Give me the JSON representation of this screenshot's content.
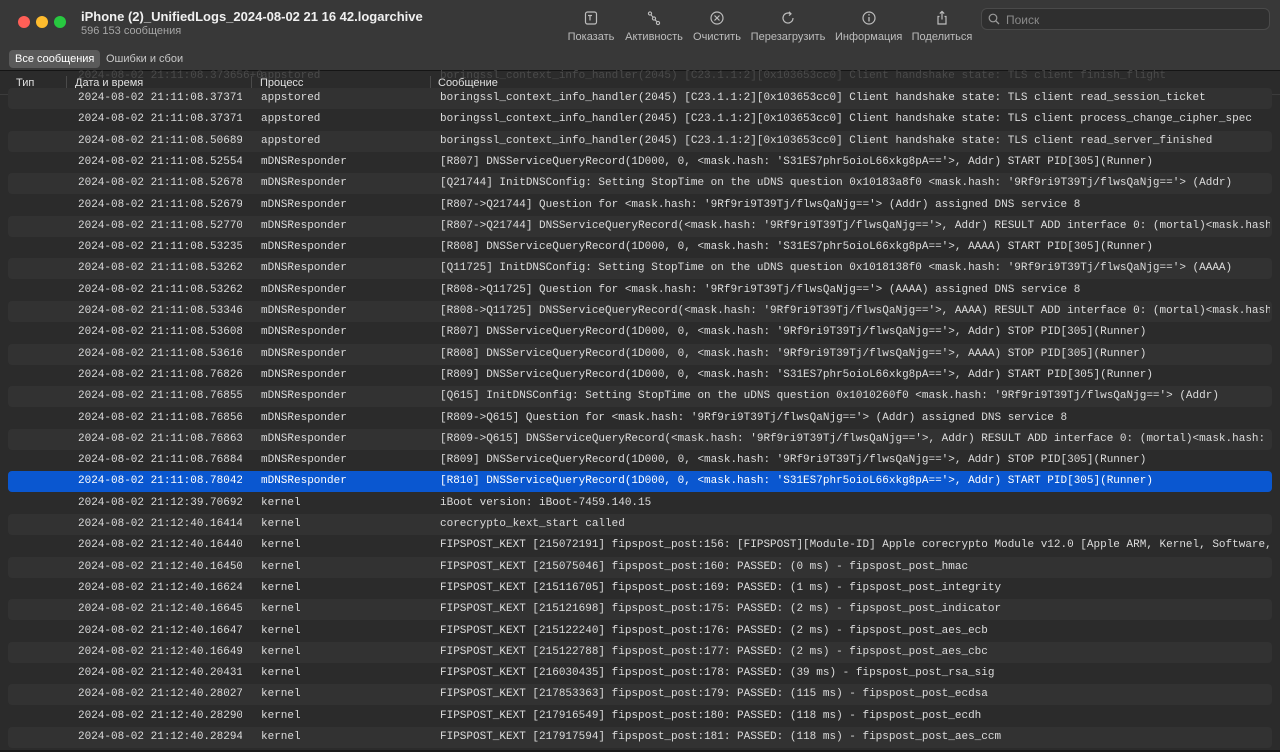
{
  "window": {
    "title": "iPhone (2)_UnifiedLogs_2024-08-02 21 16 42.logarchive",
    "subtitle": "596 153 сообщения"
  },
  "toolbar": {
    "show": "Показать",
    "activity": "Активность",
    "clear": "Очистить",
    "reload": "Перезагрузить",
    "info": "Информация",
    "share": "Поделиться"
  },
  "search": {
    "placeholder": "Поиск"
  },
  "filters": {
    "all": "Все сообщения",
    "errors": "Ошибки и сбои"
  },
  "columns": {
    "type": "Тип",
    "datetime": "Дата и время",
    "process": "Процесс",
    "message": "Сообщение"
  },
  "partial_top_row": {
    "date": "2024-08-02 21:11:08.373656+0",
    "process": "appstored",
    "message": "boringssl_context_info_handler(2045) [C23.1.1:2][0x103653cc0] Client handshake state: TLS client finish_flight"
  },
  "rows": [
    {
      "date": "2024-08-02 21:11:08.373713+0",
      "process": "appstored",
      "message": "boringssl_context_info_handler(2045) [C23.1.1:2][0x103653cc0] Client handshake state: TLS client read_session_ticket"
    },
    {
      "date": "2024-08-02 21:11:08.373713+0",
      "process": "appstored",
      "message": "boringssl_context_info_handler(2045) [C23.1.1:2][0x103653cc0] Client handshake state: TLS client process_change_cipher_spec"
    },
    {
      "date": "2024-08-02 21:11:08.506892+0",
      "process": "appstored",
      "message": "boringssl_context_info_handler(2045) [C23.1.1:2][0x103653cc0] Client handshake state: TLS client read_server_finished"
    },
    {
      "date": "2024-08-02 21:11:08.525542+0",
      "process": "mDNSResponder",
      "message": "[R807] DNSServiceQueryRecord(1D000, 0, <mask.hash: 'S31ES7phr5oioL66xkg8pA=='>, Addr) START PID[305](Runner)"
    },
    {
      "date": "2024-08-02 21:11:08.526782+0",
      "process": "mDNSResponder",
      "message": "[Q21744] InitDNSConfig: Setting StopTime on the uDNS question 0x10183a8f0 <mask.hash: '9Rf9ri9T39Tj/flwsQaNjg=='> (Addr)"
    },
    {
      "date": "2024-08-02 21:11:08.526792+0",
      "process": "mDNSResponder",
      "message": "[R807->Q21744] Question for <mask.hash: '9Rf9ri9T39Tj/flwsQaNjg=='> (Addr) assigned DNS service 8"
    },
    {
      "date": "2024-08-02 21:11:08.527704+0",
      "process": "mDNSResponder",
      "message": "[R807->Q21744] DNSServiceQueryRecord(<mask.hash: '9Rf9ri9T39Tj/flwsQaNjg=='>, Addr) RESULT ADD interface 0: (mortal)<mask.hash: 'EW2BJctr"
    },
    {
      "date": "2024-08-02 21:11:08.532357+0",
      "process": "mDNSResponder",
      "message": "[R808] DNSServiceQueryRecord(1D000, 0, <mask.hash: 'S31ES7phr5oioL66xkg8pA=='>, AAAA) START PID[305](Runner)"
    },
    {
      "date": "2024-08-02 21:11:08.532620+0",
      "process": "mDNSResponder",
      "message": "[Q11725] InitDNSConfig: Setting StopTime on the uDNS question 0x1018138f0 <mask.hash: '9Rf9ri9T39Tj/flwsQaNjg=='> (AAAA)"
    },
    {
      "date": "2024-08-02 21:11:08.532629+0",
      "process": "mDNSResponder",
      "message": "[R808->Q11725] Question for <mask.hash: '9Rf9ri9T39Tj/flwsQaNjg=='> (AAAA) assigned DNS service 8"
    },
    {
      "date": "2024-08-02 21:11:08.533467+0",
      "process": "mDNSResponder",
      "message": "[R808->Q11725] DNSServiceQueryRecord(<mask.hash: '9Rf9ri9T39Tj/flwsQaNjg=='>, AAAA) RESULT ADD interface 0: (mortal)<mask.hash: 'TTywl/Hm"
    },
    {
      "date": "2024-08-02 21:11:08.536083+0",
      "process": "mDNSResponder",
      "message": "[R807] DNSServiceQueryRecord(1D000, 0, <mask.hash: '9Rf9ri9T39Tj/flwsQaNjg=='>, Addr) STOP PID[305](Runner)"
    },
    {
      "date": "2024-08-02 21:11:08.536163+0",
      "process": "mDNSResponder",
      "message": "[R808] DNSServiceQueryRecord(1D000, 0, <mask.hash: '9Rf9ri9T39Tj/flwsQaNjg=='>, AAAA) STOP PID[305](Runner)"
    },
    {
      "date": "2024-08-02 21:11:08.768265+0",
      "process": "mDNSResponder",
      "message": "[R809] DNSServiceQueryRecord(1D000, 0, <mask.hash: 'S31ES7phr5oioL66xkg8pA=='>, Addr) START PID[305](Runner)"
    },
    {
      "date": "2024-08-02 21:11:08.768554+0",
      "process": "mDNSResponder",
      "message": "[Q615] InitDNSConfig: Setting StopTime on the uDNS question 0x1010260f0 <mask.hash: '9Rf9ri9T39Tj/flwsQaNjg=='> (Addr)"
    },
    {
      "date": "2024-08-02 21:11:08.768563+0",
      "process": "mDNSResponder",
      "message": "[R809->Q615] Question for <mask.hash: '9Rf9ri9T39Tj/flwsQaNjg=='> (Addr) assigned DNS service 8"
    },
    {
      "date": "2024-08-02 21:11:08.768630+0",
      "process": "mDNSResponder",
      "message": "[R809->Q615] DNSServiceQueryRecord(<mask.hash: '9Rf9ri9T39Tj/flwsQaNjg=='>, Addr) RESULT ADD interface 0: (mortal)<mask.hash: 'EW2BJctnoc"
    },
    {
      "date": "2024-08-02 21:11:08.768846+0",
      "process": "mDNSResponder",
      "message": "[R809] DNSServiceQueryRecord(1D000, 0, <mask.hash: '9Rf9ri9T39Tj/flwsQaNjg=='>, Addr) STOP PID[305](Runner)"
    },
    {
      "date": "2024-08-02 21:11:08.780425+0",
      "process": "mDNSResponder",
      "message": "[R810] DNSServiceQueryRecord(1D000, 0, <mask.hash: 'S31ES7phr5oioL66xkg8pA=='>, Addr) START PID[305](Runner)",
      "selected": true
    },
    {
      "date": "2024-08-02 21:12:39.706922+0",
      "process": "kernel",
      "message": "iBoot version: iBoot-7459.140.15"
    },
    {
      "date": "2024-08-02 21:12:40.164144+0",
      "process": "kernel",
      "message": "corecrypto_kext_start called"
    },
    {
      "date": "2024-08-02 21:12:40.164406+0",
      "process": "kernel",
      "message": "FIPSPOST_KEXT [215072191] fipspost_post:156: [FIPSPOST][Module-ID] Apple corecrypto Module v12.0 [Apple ARM, Kernel, Software, SL1]"
    },
    {
      "date": "2024-08-02 21:12:40.164509+0",
      "process": "kernel",
      "message": "FIPSPOST_KEXT [215075046] fipspost_post:160: PASSED: (0 ms) - fipspost_post_hmac"
    },
    {
      "date": "2024-08-02 21:12:40.166244+0",
      "process": "kernel",
      "message": "FIPSPOST_KEXT [215116705] fipspost_post:169: PASSED: (1 ms) - fipspost_post_integrity"
    },
    {
      "date": "2024-08-02 21:12:40.166450+0",
      "process": "kernel",
      "message": "FIPSPOST_KEXT [215121698] fipspost_post:175: PASSED: (2 ms) - fipspost_post_indicator"
    },
    {
      "date": "2024-08-02 21:12:40.166472+0",
      "process": "kernel",
      "message": "FIPSPOST_KEXT [215122240] fipspost_post:176: PASSED: (2 ms) - fipspost_post_aes_ecb"
    },
    {
      "date": "2024-08-02 21:12:40.166496+0",
      "process": "kernel",
      "message": "FIPSPOST_KEXT [215122788] fipspost_post:177: PASSED: (2 ms) - fipspost_post_aes_cbc"
    },
    {
      "date": "2024-08-02 21:12:40.204319+0",
      "process": "kernel",
      "message": "FIPSPOST_KEXT [216030435] fipspost_post:178: PASSED: (39 ms) - fipspost_post_rsa_sig"
    },
    {
      "date": "2024-08-02 21:12:40.280275+0",
      "process": "kernel",
      "message": "FIPSPOST_KEXT [217853363] fipspost_post:179: PASSED: (115 ms) - fipspost_post_ecdsa"
    },
    {
      "date": "2024-08-02 21:12:40.282903+0",
      "process": "kernel",
      "message": "FIPSPOST_KEXT [217916549] fipspost_post:180: PASSED: (118 ms) - fipspost_post_ecdh"
    },
    {
      "date": "2024-08-02 21:12:40.282946+0",
      "process": "kernel",
      "message": "FIPSPOST_KEXT [217917594] fipspost_post:181: PASSED: (118 ms) - fipspost_post_aes_ccm"
    }
  ],
  "colors": {
    "selection": "#0a57d0",
    "close": "#fe5f57",
    "minimize": "#febc2e",
    "maximize": "#28c840"
  }
}
